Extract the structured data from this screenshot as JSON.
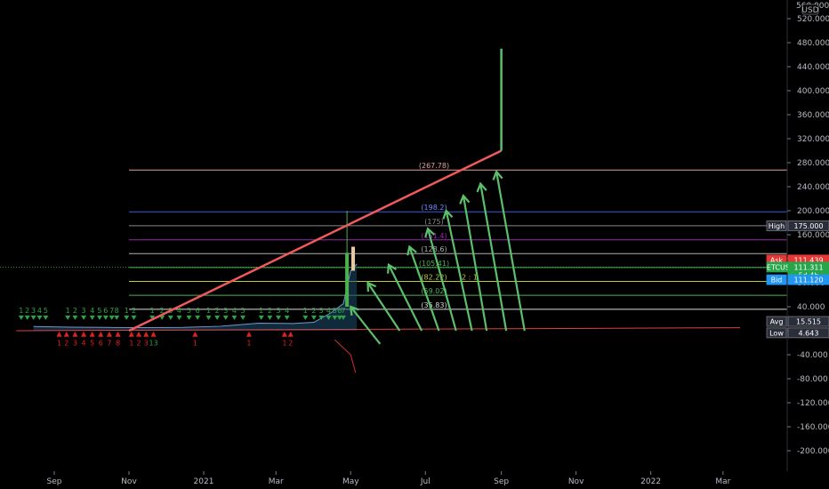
{
  "chart_data": {
    "type": "line",
    "symbol": "ETCUSD",
    "currency": "USD",
    "y_axis": {
      "ticks": [
        520,
        480,
        440,
        400,
        360,
        320,
        280,
        240,
        200,
        160,
        120,
        80,
        40,
        0,
        -40,
        -80,
        -120,
        -160,
        -200
      ],
      "tick_labels": [
        "520.000",
        "480.000",
        "440.000",
        "400.000",
        "360.000",
        "320.000",
        "280.000",
        "240.000",
        "200.000",
        "160.000",
        "120.000",
        "80.000",
        "40.000",
        "0.000",
        "-40.000",
        "-80.000",
        "-120.000",
        "-160.000",
        "-200.000"
      ],
      "top_label": "560.000"
    },
    "x_axis": {
      "labels": [
        {
          "text": "Sep",
          "date": "2020-09-01"
        },
        {
          "text": "Nov",
          "date": "2020-11-01"
        },
        {
          "text": "2021",
          "date": "2021-01-01"
        },
        {
          "text": "Mar",
          "date": "2021-03-01"
        },
        {
          "text": "May",
          "date": "2021-05-01"
        },
        {
          "text": "Jul",
          "date": "2021-07-01"
        },
        {
          "text": "Sep",
          "date": "2021-09-01"
        },
        {
          "text": "Nov",
          "date": "2021-11-01"
        },
        {
          "text": "2022",
          "date": "2022-01-01"
        },
        {
          "text": "Mar",
          "date": "2022-03-01"
        }
      ]
    },
    "price_series": [
      {
        "date": "2020-08-15",
        "close": 7.0
      },
      {
        "date": "2020-09-15",
        "close": 6.0
      },
      {
        "date": "2020-10-15",
        "close": 5.5
      },
      {
        "date": "2020-11-15",
        "close": 5.2
      },
      {
        "date": "2020-12-15",
        "close": 5.5
      },
      {
        "date": "2021-01-15",
        "close": 7.5
      },
      {
        "date": "2021-02-15",
        "close": 12.5
      },
      {
        "date": "2021-03-15",
        "close": 12.0
      },
      {
        "date": "2021-04-01",
        "close": 14.0
      },
      {
        "date": "2021-04-15",
        "close": 30.0
      },
      {
        "date": "2021-04-25",
        "close": 45.0
      },
      {
        "date": "2021-05-01",
        "close": 100.0
      },
      {
        "date": "2021-05-06",
        "close": 111.311
      }
    ],
    "fib_levels": [
      {
        "label": "(267.78)",
        "value": 267.78,
        "color": "#e0a0a0"
      },
      {
        "label": "(198.2)",
        "value": 198.2,
        "color": "#3a5bd9"
      },
      {
        "label": "(175)",
        "value": 175,
        "color": "#888888"
      },
      {
        "label": "(151.4)",
        "value": 151.4,
        "color": "#9c27b0"
      },
      {
        "label": "(128.6)",
        "value": 128.6,
        "color": "#b0b0b0"
      },
      {
        "label": "(105.41)",
        "value": 105.41,
        "color": "#4caf50"
      },
      {
        "label": "(82.22)",
        "value": 82.22,
        "color": "#c0ca33"
      },
      {
        "label": "(59.02)",
        "value": 59.02,
        "color": "#4caf50"
      },
      {
        "label": "(35.83)",
        "value": 35.83,
        "color": "#dddddd"
      }
    ],
    "annotation_ratio": "2 : 1",
    "trendline": {
      "from": {
        "date": "2020-11-01",
        "value": 0
      },
      "to": {
        "date": "2021-09-01",
        "value": 300
      },
      "color": "#f05a5a"
    },
    "projection_line": {
      "from": {
        "date": "2021-09-01",
        "value": 300
      },
      "to": {
        "date": "2021-09-01",
        "value": 470
      },
      "color": "#5cbf6a"
    },
    "arrows": [
      {
        "from": {
          "date": "2021-05-25",
          "value": -22
        },
        "to": {
          "date": "2021-05-01",
          "value": 40
        }
      },
      {
        "from": {
          "date": "2021-06-10",
          "value": 0
        },
        "to": {
          "date": "2021-05-15",
          "value": 80
        }
      },
      {
        "from": {
          "date": "2021-06-28",
          "value": 0
        },
        "to": {
          "date": "2021-06-01",
          "value": 110
        }
      },
      {
        "from": {
          "date": "2021-07-12",
          "value": 0
        },
        "to": {
          "date": "2021-06-18",
          "value": 140
        }
      },
      {
        "from": {
          "date": "2021-07-26",
          "value": 0
        },
        "to": {
          "date": "2021-07-03",
          "value": 170
        }
      },
      {
        "from": {
          "date": "2021-08-08",
          "value": 0
        },
        "to": {
          "date": "2021-07-18",
          "value": 200
        }
      },
      {
        "from": {
          "date": "2021-08-20",
          "value": 0
        },
        "to": {
          "date": "2021-08-01",
          "value": 225
        }
      },
      {
        "from": {
          "date": "2021-09-05",
          "value": 0
        },
        "to": {
          "date": "2021-08-15",
          "value": 245
        }
      },
      {
        "from": {
          "date": "2021-09-20",
          "value": 0
        },
        "to": {
          "date": "2021-08-28",
          "value": 265
        }
      }
    ],
    "red_horizontal": {
      "from": {
        "date": "2020-08-01",
        "value": 0
      },
      "to": {
        "date": "2022-03-15",
        "value": 5
      },
      "color": "#e04040"
    },
    "td_sequential_buy_top": [
      {
        "date": "2020-08-05",
        "text": "1"
      },
      {
        "date": "2020-08-10",
        "text": "2"
      },
      {
        "date": "2020-08-15",
        "text": "3"
      },
      {
        "date": "2020-08-20",
        "text": "4"
      },
      {
        "date": "2020-08-25",
        "text": "5"
      },
      {
        "date": "2020-09-12",
        "text": "1"
      },
      {
        "date": "2020-09-18",
        "text": "2"
      },
      {
        "date": "2020-09-25",
        "text": "3"
      },
      {
        "date": "2020-10-02",
        "text": "4"
      },
      {
        "date": "2020-10-08",
        "text": "5"
      },
      {
        "date": "2020-10-13",
        "text": "6"
      },
      {
        "date": "2020-10-18",
        "text": "7"
      },
      {
        "date": "2020-10-22",
        "text": "8"
      },
      {
        "date": "2020-10-30",
        "text": "1"
      },
      {
        "date": "2020-11-05",
        "text": "2"
      },
      {
        "date": "2020-11-20",
        "text": "1"
      },
      {
        "date": "2020-11-28",
        "text": "2"
      },
      {
        "date": "2020-12-05",
        "text": "3"
      },
      {
        "date": "2020-12-12",
        "text": "4"
      },
      {
        "date": "2020-12-20",
        "text": "5"
      },
      {
        "date": "2020-12-27",
        "text": "6"
      },
      {
        "date": "2021-01-05",
        "text": "1"
      },
      {
        "date": "2021-01-12",
        "text": "2"
      },
      {
        "date": "2021-01-19",
        "text": "3"
      },
      {
        "date": "2021-01-26",
        "text": "4"
      },
      {
        "date": "2021-02-02",
        "text": "5"
      },
      {
        "date": "2021-02-17",
        "text": "1"
      },
      {
        "date": "2021-02-24",
        "text": "2"
      },
      {
        "date": "2021-03-03",
        "text": "3"
      },
      {
        "date": "2021-03-10",
        "text": "4"
      },
      {
        "date": "2021-03-25",
        "text": "1"
      },
      {
        "date": "2021-04-01",
        "text": "2"
      },
      {
        "date": "2021-04-07",
        "text": "3"
      },
      {
        "date": "2021-04-13",
        "text": "4"
      },
      {
        "date": "2021-04-18",
        "text": "5"
      },
      {
        "date": "2021-04-22",
        "text": "6"
      },
      {
        "date": "2021-04-25",
        "text": "7"
      }
    ],
    "td_sequential_sell_bottom": [
      {
        "date": "2020-09-05",
        "text": "1"
      },
      {
        "date": "2020-09-11",
        "text": "2"
      },
      {
        "date": "2020-09-18",
        "text": "3"
      },
      {
        "date": "2020-09-25",
        "text": "4"
      },
      {
        "date": "2020-10-02",
        "text": "5"
      },
      {
        "date": "2020-10-09",
        "text": "6"
      },
      {
        "date": "2020-10-16",
        "text": "7"
      },
      {
        "date": "2020-10-23",
        "text": "8"
      },
      {
        "date": "2020-11-03",
        "text": "1"
      },
      {
        "date": "2020-11-09",
        "text": "2"
      },
      {
        "date": "2020-11-15",
        "text": "3"
      },
      {
        "date": "2020-11-21",
        "text": "13"
      },
      {
        "date": "2020-12-25",
        "text": "1"
      },
      {
        "date": "2021-02-07",
        "text": "1"
      },
      {
        "date": "2021-03-08",
        "text": "1"
      },
      {
        "date": "2021-03-13",
        "text": "2"
      }
    ],
    "price_tags": [
      {
        "label": "High",
        "value": "175.000",
        "price": 175.0,
        "bg": "#2a2e39",
        "border": "#787b86"
      },
      {
        "label": "Ask",
        "value": "111.439",
        "price": 118.0,
        "bg": "#e53935",
        "border": "#e53935"
      },
      {
        "label": "ETCUSD",
        "value": "111.311",
        "price": 106.0,
        "bg": "#26a64a",
        "border": "#26a64a",
        "sub": "5d 4h"
      },
      {
        "label": "Bid",
        "value": "111.120",
        "price": 85.0,
        "bg": "#2196f3",
        "border": "#2196f3"
      },
      {
        "label": "Avg",
        "value": "15.515",
        "price": 15.515,
        "bg": "#2a2e39",
        "border": "#787b86"
      },
      {
        "label": "Low",
        "value": "4.643",
        "price": -3.5,
        "bg": "#2a2e39",
        "border": "#787b86"
      }
    ],
    "grid": false,
    "colors": {
      "background": "#000000",
      "axis_text": "#b8bcc4",
      "buy": "#2aa545",
      "sell": "#e02020"
    }
  }
}
